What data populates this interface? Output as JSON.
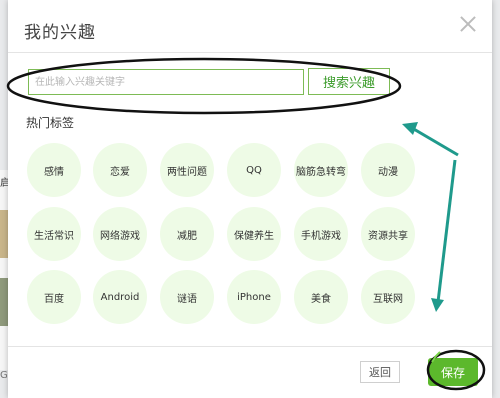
{
  "dialog": {
    "title": "我的兴趣",
    "close_icon": "close-icon"
  },
  "search": {
    "placeholder": "在此输入兴趣关键字",
    "button_label": "搜索兴趣"
  },
  "hot_tags": {
    "label": "热门标签",
    "rows": [
      [
        "感情",
        "恋爱",
        "两性问题",
        "QQ",
        "脑筋急转弯",
        "动漫"
      ],
      [
        "生活常识",
        "网络游戏",
        "减肥",
        "保健养生",
        "手机游戏",
        "资源共享"
      ],
      [
        "百度",
        "Android",
        "谜语",
        "iPhone",
        "美食",
        "互联网"
      ]
    ]
  },
  "footer": {
    "back_label": "返回",
    "save_label": "保存"
  },
  "background": {
    "left_text_top": "启",
    "left_text_bottom": "G"
  },
  "colors": {
    "accent_green": "#5cb82c",
    "tag_background": "#eefbe6",
    "annotation_teal": "#1f9a8c",
    "annotation_black": "#111111"
  }
}
